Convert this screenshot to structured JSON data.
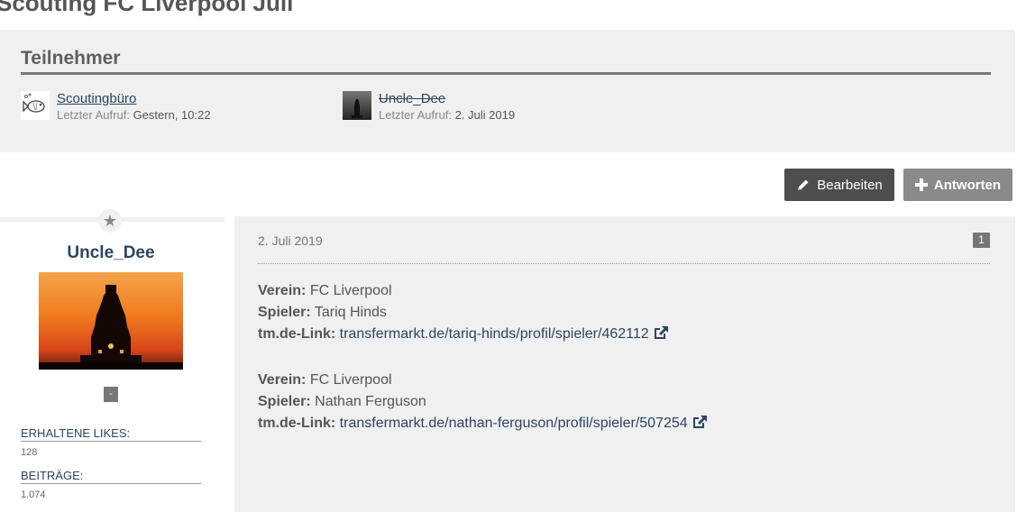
{
  "page": {
    "title": "Scouting FC Liverpool Juli"
  },
  "participants": {
    "heading": "Teilnehmer",
    "last_visit_label": "Letzter Aufruf:",
    "items": [
      {
        "name": "Scoutingbüro",
        "last_visit": "Gestern, 10:22",
        "avatar_icon": "fish-icon"
      },
      {
        "name": "Uncle_Dee",
        "last_visit": "2. Juli 2019",
        "avatar_icon": "monument-icon"
      }
    ]
  },
  "actions": {
    "edit_label": "Bearbeiten",
    "reply_label": "Antworten"
  },
  "author": {
    "name": "Uncle_Dee",
    "rank": "-",
    "stats": [
      {
        "label": "ERHALTENE LIKES:",
        "value": "128"
      },
      {
        "label": "BEITRÄGE:",
        "value": "1.074"
      }
    ]
  },
  "post": {
    "date": "2. Juli 2019",
    "number": "1",
    "entries": [
      {
        "club_label": "Verein:",
        "club": "FC Liverpool",
        "player_label": "Spieler:",
        "player": "Tariq Hinds",
        "link_label": "tm.de-Link:",
        "link": "transfermarkt.de/tariq-hinds/profil/spieler/462112"
      },
      {
        "club_label": "Verein:",
        "club": "FC Liverpool",
        "player_label": "Spieler:",
        "player": "Nathan Ferguson",
        "link_label": "tm.de-Link:",
        "link": "transfermarkt.de/nathan-ferguson/profil/spieler/507254"
      }
    ]
  },
  "colors": {
    "link": "#2c4463",
    "panel": "#f0f0f0",
    "button_dark": "#4e4e4e",
    "button_light": "#8a8a8a"
  }
}
